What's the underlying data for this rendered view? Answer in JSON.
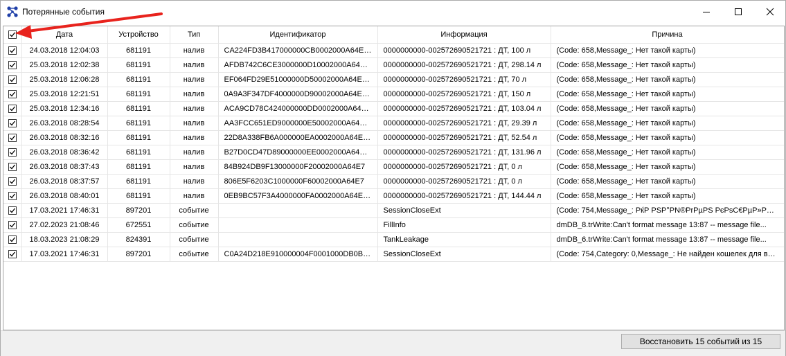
{
  "window": {
    "title": "Потерянные события"
  },
  "columns": {
    "date": "Дата",
    "device": "Устройство",
    "type": "Тип",
    "identifier": "Идентификатор",
    "info": "Информация",
    "reason": "Причина"
  },
  "rows": [
    {
      "date": "24.03.2018 12:04:03",
      "device": "681191",
      "type": "налив",
      "identifier": "CA224FD3B417000000CB0002000A64E7 ...",
      "info": "0000000000-002572690521721 : ДТ, 100 л",
      "reason": "(Code: 658,Message_: Нет такой карты)"
    },
    {
      "date": "25.03.2018 12:02:38",
      "device": "681191",
      "type": "налив",
      "identifier": "AFDB742C6CE3000000D10002000A64E7 ...",
      "info": "0000000000-002572690521721 : ДТ, 298.14 л",
      "reason": "(Code: 658,Message_: Нет такой карты)"
    },
    {
      "date": "25.03.2018 12:06:28",
      "device": "681191",
      "type": "налив",
      "identifier": "EF064FD29E51000000D50002000A64E7 ...",
      "info": "0000000000-002572690521721 : ДТ, 70 л",
      "reason": "(Code: 658,Message_: Нет такой карты)"
    },
    {
      "date": "25.03.2018 12:21:51",
      "device": "681191",
      "type": "налив",
      "identifier": "0A9A3F347DF4000000D90002000A64E7 ...",
      "info": "0000000000-002572690521721 : ДТ, 150 л",
      "reason": "(Code: 658,Message_: Нет такой карты)"
    },
    {
      "date": "25.03.2018 12:34:16",
      "device": "681191",
      "type": "налив",
      "identifier": "ACA9CD78C424000000DD0002000A64E7...",
      "info": "0000000000-002572690521721 : ДТ, 103.04 л",
      "reason": "(Code: 658,Message_: Нет такой карты)"
    },
    {
      "date": "26.03.2018 08:28:54",
      "device": "681191",
      "type": "налив",
      "identifier": "AA3FCC651ED9000000E50002000A64E7...",
      "info": "0000000000-002572690521721 : ДТ, 29.39 л",
      "reason": "(Code: 658,Message_: Нет такой карты)"
    },
    {
      "date": "26.03.2018 08:32:16",
      "device": "681191",
      "type": "налив",
      "identifier": "22D8A338FB6A000000EA0002000A64E7 ...",
      "info": "0000000000-002572690521721 : ДТ, 52.54 л",
      "reason": "(Code: 658,Message_: Нет такой карты)"
    },
    {
      "date": "26.03.2018 08:36:42",
      "device": "681191",
      "type": "налив",
      "identifier": "B27D0CD47D89000000EE0002000A64E7...",
      "info": "0000000000-002572690521721 : ДТ, 131.96 л",
      "reason": "(Code: 658,Message_: Нет такой карты)"
    },
    {
      "date": "26.03.2018 08:37:43",
      "device": "681191",
      "type": "налив",
      "identifier": "84B924DB9F13000000F20002000A64E7",
      "info": "0000000000-002572690521721 : ДТ, 0 л",
      "reason": "(Code: 658,Message_: Нет такой карты)"
    },
    {
      "date": "26.03.2018 08:37:57",
      "device": "681191",
      "type": "налив",
      "identifier": "806E5F6203C1000000F60002000A64E7",
      "info": "0000000000-002572690521721 : ДТ, 0 л",
      "reason": "(Code: 658,Message_: Нет такой карты)"
    },
    {
      "date": "26.03.2018 08:40:01",
      "device": "681191",
      "type": "налив",
      "identifier": "0EB9BC57F3A4000000FA0002000A64E7 ...",
      "info": "0000000000-002572690521721 : ДТ, 144.44 л",
      "reason": "(Code: 658,Message_: Нет такой карты)"
    },
    {
      "date": "17.03.2021 17:46:31",
      "device": "897201",
      "type": "событие",
      "identifier": "",
      "info": "SessionCloseExt",
      "reason": "(Code: 754,Message_: РќР PSP°PN®PrPµPS PєPsC€PµP»PµPє ..."
    },
    {
      "date": "27.02.2023 21:08:46",
      "device": "672551",
      "type": "событие",
      "identifier": "",
      "info": "FillInfo",
      "reason": "dmDB_8.trWrite:Can't format message 13:87 -- message file..."
    },
    {
      "date": "18.03.2023 21:08:29",
      "device": "824391",
      "type": "событие",
      "identifier": "",
      "info": "TankLeakage",
      "reason": "dmDB_6.trWrite:Can't format message 13:87 -- message file..."
    },
    {
      "date": "17.03.2021 17:46:31",
      "device": "897201",
      "type": "событие",
      "identifier": "C0A24D218E910000004F0001000DB0B1 ...",
      "info": "SessionCloseExt",
      "reason": "(Code: 754,Category: 0,Message_: Не найден кошелек для ви..."
    }
  ],
  "footer": {
    "restore_label": "Восстановить 15 событий из 15"
  },
  "colors": {
    "arrow": "#e8231d",
    "icon": "#1f3fa8",
    "grid_line": "#e5e5e5",
    "status_bg": "#f0f0f0"
  },
  "icons": {
    "app": "network-nodes-icon",
    "minimize": "minimize-icon",
    "maximize": "maximize-icon",
    "close": "close-icon",
    "checkbox": "checkbox-checked-icon"
  }
}
